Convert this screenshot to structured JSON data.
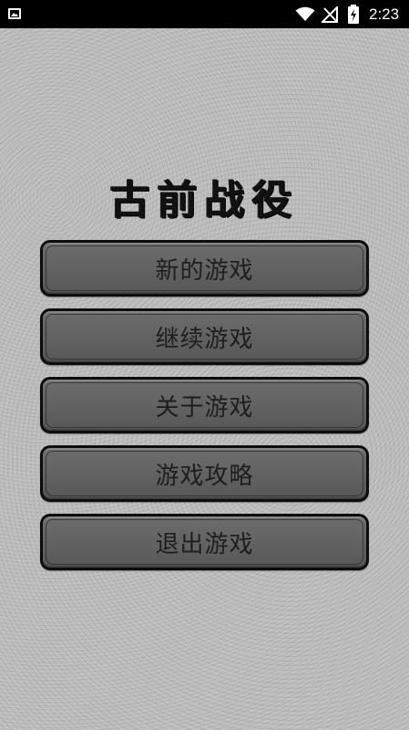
{
  "status_bar": {
    "time": "2:23",
    "icons": [
      "image-notification-icon",
      "wifi-icon",
      "no-sim-signal-icon",
      "battery-charging-icon"
    ]
  },
  "title": "古前战役",
  "menu": {
    "items": [
      {
        "label": "新的游戏"
      },
      {
        "label": "继续游戏"
      },
      {
        "label": "关于游戏"
      },
      {
        "label": "游戏攻略"
      },
      {
        "label": "退出游戏"
      }
    ]
  },
  "colors": {
    "background": "#bdbdbd",
    "button_fill": "#616161",
    "button_border": "#0d0d0d",
    "text": "#1e1e1e",
    "status_bar": "#000000"
  }
}
